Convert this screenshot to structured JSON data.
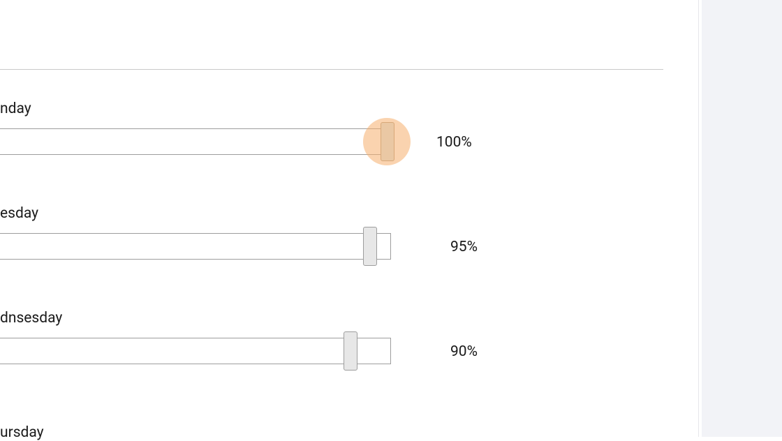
{
  "sliders": [
    {
      "label": "nday",
      "value_label": "100%",
      "percent": 100,
      "highlighted": true
    },
    {
      "label": "esday",
      "value_label": "95%",
      "percent": 95,
      "highlighted": false
    },
    {
      "label": "dnsesday",
      "value_label": "90%",
      "percent": 90,
      "highlighted": false
    },
    {
      "label": "ursday",
      "value_label": "",
      "percent": null,
      "highlighted": false
    }
  ]
}
